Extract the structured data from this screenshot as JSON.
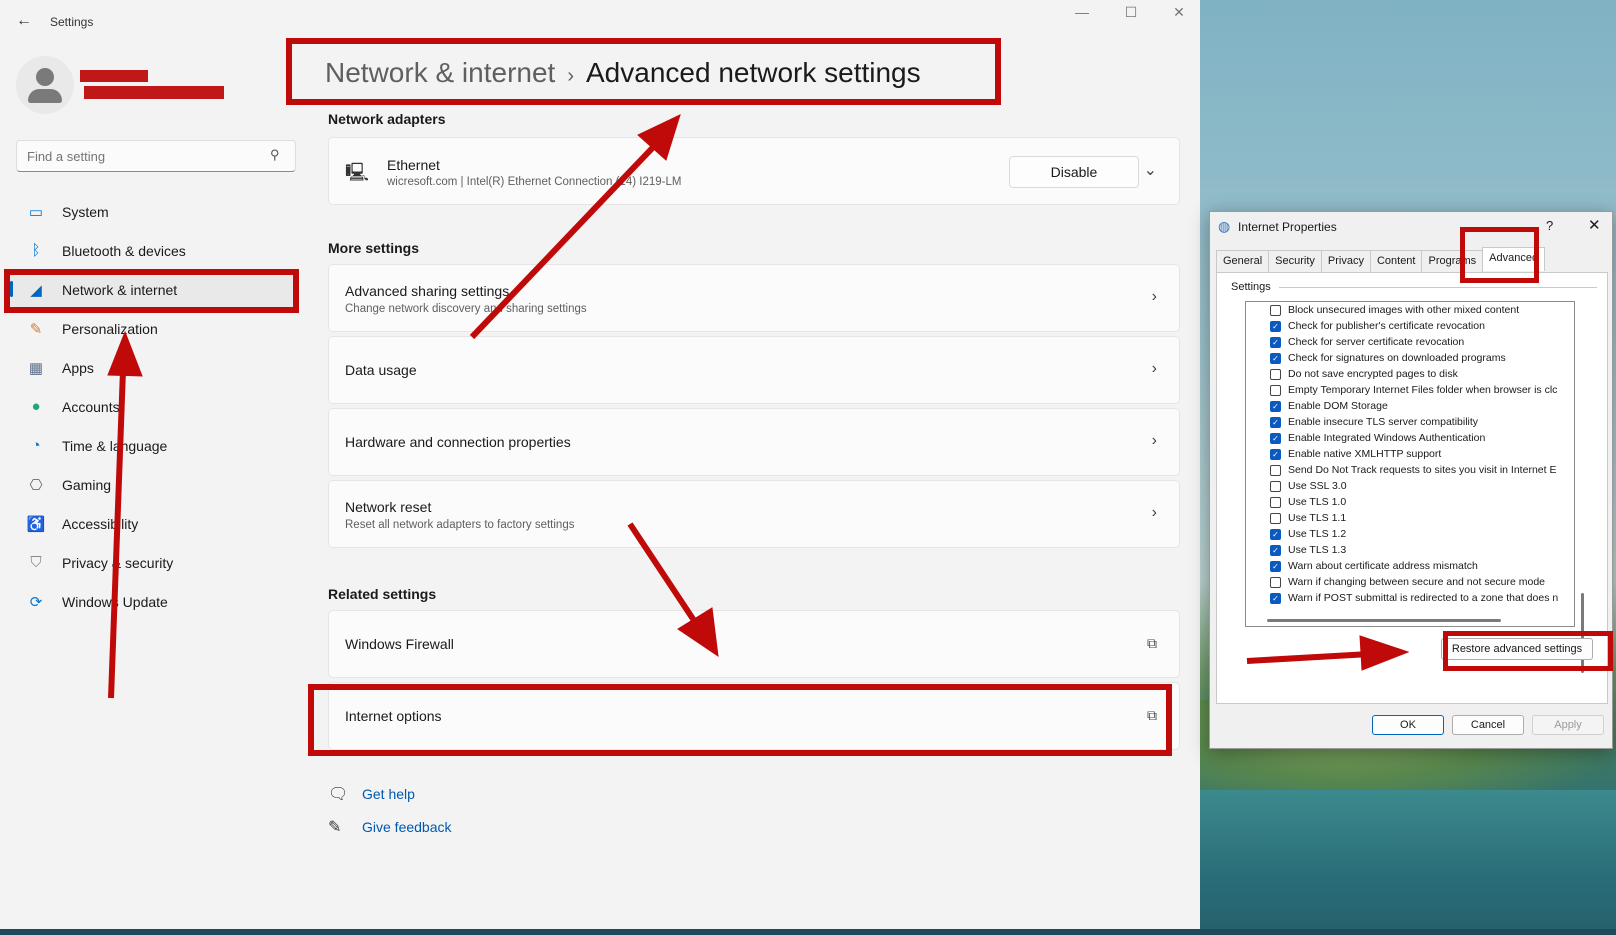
{
  "window": {
    "app_title": "Settings",
    "back_icon": "back-arrow-icon",
    "controls": [
      "minimize-icon",
      "maximize-icon",
      "close-icon"
    ]
  },
  "sidebar": {
    "search_placeholder": "Find a setting",
    "items": [
      {
        "label": "System",
        "icon": "system-icon",
        "color": "#0078d4"
      },
      {
        "label": "Bluetooth & devices",
        "icon": "bluetooth-icon",
        "color": "#0078d4"
      },
      {
        "label": "Network & internet",
        "icon": "wifi-icon",
        "color": "#0067c0",
        "active": true
      },
      {
        "label": "Personalization",
        "icon": "brush-icon",
        "color": "#d87a36"
      },
      {
        "label": "Apps",
        "icon": "apps-icon",
        "color": "#5b6f8c"
      },
      {
        "label": "Accounts",
        "icon": "accounts-icon",
        "color": "#21a67a"
      },
      {
        "label": "Time & language",
        "icon": "globe-clock-icon",
        "color": "#0078d4"
      },
      {
        "label": "Gaming",
        "icon": "gamepad-icon",
        "color": "#6b6b6b"
      },
      {
        "label": "Accessibility",
        "icon": "accessibility-icon",
        "color": "#0a72c8"
      },
      {
        "label": "Privacy & security",
        "icon": "shield-icon",
        "color": "#8a8a8a"
      },
      {
        "label": "Windows Update",
        "icon": "update-icon",
        "color": "#0078d4"
      }
    ]
  },
  "main": {
    "breadcrumb_parent": "Network & internet",
    "breadcrumb_sep": "›",
    "breadcrumb_current": "Advanced network settings",
    "adapters_title": "Network adapters",
    "ethernet": {
      "title": "Ethernet",
      "subtitle": "wicresoft.com | Intel(R) Ethernet Connection (14) I219-LM",
      "button": "Disable"
    },
    "more_title": "More settings",
    "more_items": [
      {
        "title": "Advanced sharing settings",
        "subtitle": "Change network discovery and sharing settings"
      },
      {
        "title": "Data usage",
        "subtitle": ""
      },
      {
        "title": "Hardware and connection properties",
        "subtitle": ""
      },
      {
        "title": "Network reset",
        "subtitle": "Reset all network adapters to factory settings"
      }
    ],
    "related_title": "Related settings",
    "related_items": [
      {
        "title": "Windows Firewall"
      },
      {
        "title": "Internet options"
      }
    ],
    "help": [
      {
        "label": "Get help",
        "icon": "help-chat-icon"
      },
      {
        "label": "Give feedback",
        "icon": "feedback-icon"
      }
    ]
  },
  "dialog": {
    "title": "Internet Properties",
    "help": "?",
    "close": "✕",
    "tabs": [
      "General",
      "Security",
      "Privacy",
      "Content",
      "Programs",
      "Advanced"
    ],
    "active_tab": "Advanced",
    "settings_label": "Settings",
    "options": [
      {
        "label": "Block unsecured images with other mixed content",
        "checked": false
      },
      {
        "label": "Check for publisher's certificate revocation",
        "checked": true
      },
      {
        "label": "Check for server certificate revocation",
        "checked": true
      },
      {
        "label": "Check for signatures on downloaded programs",
        "checked": true
      },
      {
        "label": "Do not save encrypted pages to disk",
        "checked": false
      },
      {
        "label": "Empty Temporary Internet Files folder when browser is clc",
        "checked": false
      },
      {
        "label": "Enable DOM Storage",
        "checked": true
      },
      {
        "label": "Enable insecure TLS server compatibility",
        "checked": true
      },
      {
        "label": "Enable Integrated Windows Authentication",
        "checked": true
      },
      {
        "label": "Enable native XMLHTTP support",
        "checked": true
      },
      {
        "label": "Send Do Not Track requests to sites you visit in Internet E",
        "checked": false
      },
      {
        "label": "Use SSL 3.0",
        "checked": false
      },
      {
        "label": "Use TLS 1.0",
        "checked": false
      },
      {
        "label": "Use TLS 1.1",
        "checked": false
      },
      {
        "label": "Use TLS 1.2",
        "checked": true
      },
      {
        "label": "Use TLS 1.3",
        "checked": true
      },
      {
        "label": "Warn about certificate address mismatch",
        "checked": true
      },
      {
        "label": "Warn if changing between secure and not secure mode",
        "checked": false
      },
      {
        "label": "Warn if POST submittal is redirected to a zone that does n",
        "checked": true
      }
    ],
    "restore_button": "Restore advanced settings",
    "ok": "OK",
    "cancel": "Cancel",
    "apply": "Apply"
  },
  "annotations": {
    "color": "#c00a0a"
  }
}
